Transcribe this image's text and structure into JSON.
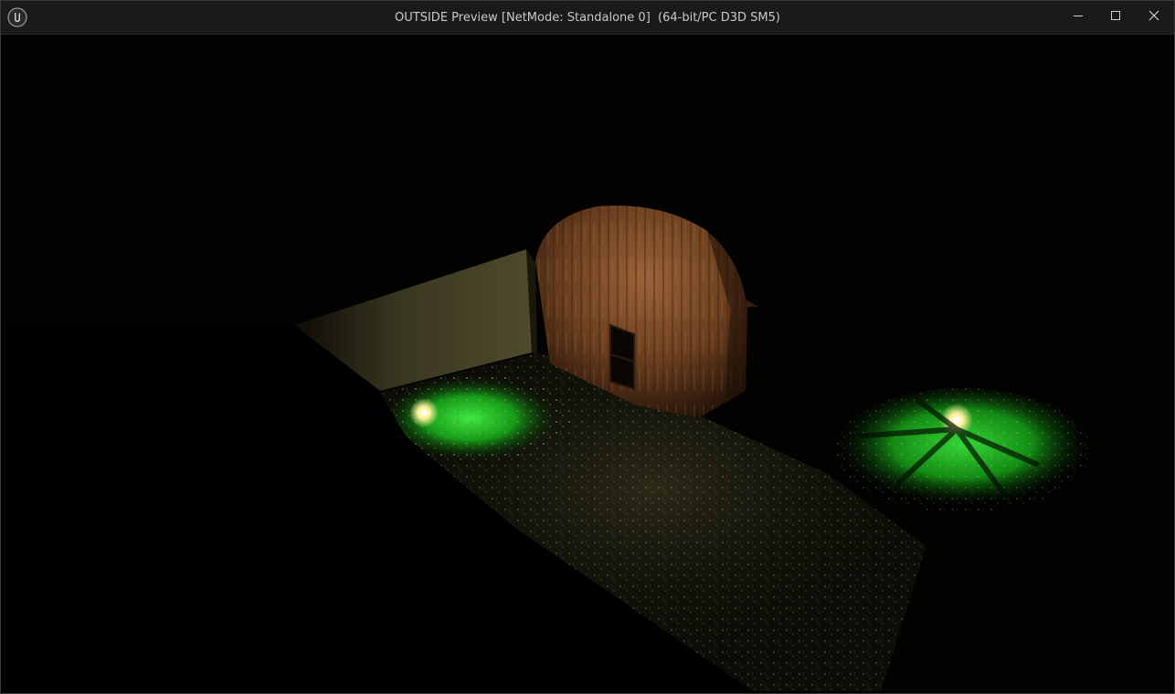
{
  "window": {
    "title": "OUTSIDE Preview [NetMode: Standalone 0]  (64-bit/PC D3D SM5)",
    "app_icon": "unreal-engine-logo-icon",
    "controls": [
      {
        "name": "minimize-icon"
      },
      {
        "name": "maximize-icon"
      },
      {
        "name": "close-icon"
      }
    ]
  },
  "scene": {
    "description_icon": "game-viewport",
    "colors": {
      "background": "#020201",
      "ground_shadow": "#000000",
      "wall": "#4a4628",
      "shed_wood": "#7a4a26",
      "grass_lit": "#1aa21a",
      "lamp_glow": "#fff2a0"
    }
  }
}
